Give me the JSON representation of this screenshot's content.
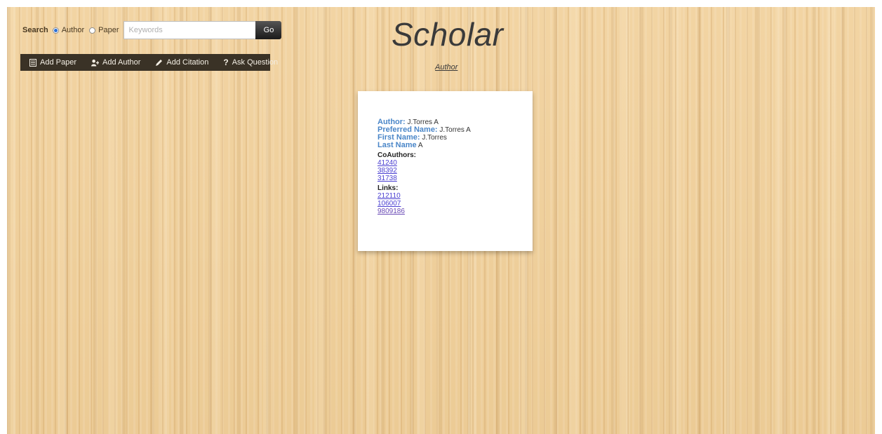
{
  "search": {
    "label": "Search",
    "options": [
      {
        "label": "Author",
        "selected": true
      },
      {
        "label": "Paper",
        "selected": false
      }
    ],
    "placeholder": "Keywords",
    "value": "",
    "go_label": "Go"
  },
  "toolbar": {
    "items": [
      {
        "label": "Add Paper",
        "icon": "document-icon"
      },
      {
        "label": "Add Author",
        "icon": "add-user-icon"
      },
      {
        "label": "Add Citation",
        "icon": "pencil-icon"
      },
      {
        "label": "Ask Question",
        "icon": "question-icon"
      }
    ]
  },
  "header": {
    "title": "Scholar",
    "nav_link": "Author"
  },
  "author_card": {
    "author_key": "Author:",
    "author_value": "J.Torres A",
    "preferred_key": "Preferred Name:",
    "preferred_value": "J.Torres A",
    "first_key": "First Name:",
    "first_value": "J.Torres",
    "last_key": "Last Name",
    "last_value": "A",
    "coauthors_title": "CoAuthors:",
    "coauthors": [
      "41240",
      "38392",
      "31738"
    ],
    "links_title": "Links:",
    "links": [
      "212110",
      "106007",
      "9809186"
    ]
  },
  "colors": {
    "wood_background": "#efcd98",
    "toolbar_background": "#3a3226",
    "field_key": "#4a86c8",
    "link": "#4a3fd1"
  }
}
